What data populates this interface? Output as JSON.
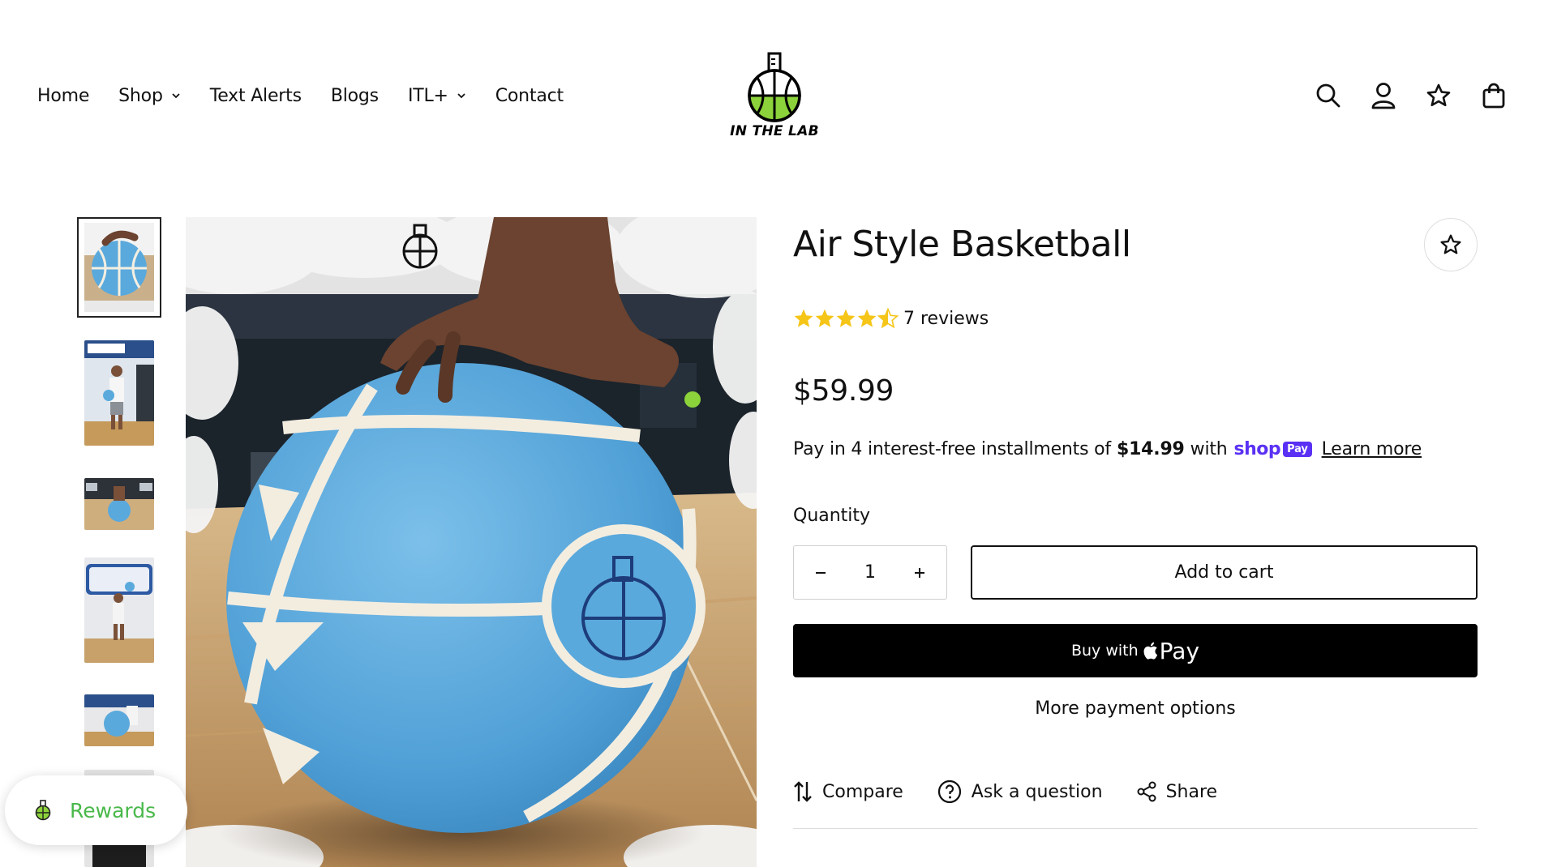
{
  "header": {
    "nav": [
      {
        "label": "Home",
        "has_dropdown": false
      },
      {
        "label": "Shop",
        "has_dropdown": true
      },
      {
        "label": "Text Alerts",
        "has_dropdown": false
      },
      {
        "label": "Blogs",
        "has_dropdown": false
      },
      {
        "label": "ITL+",
        "has_dropdown": true
      },
      {
        "label": "Contact",
        "has_dropdown": false
      }
    ],
    "logo_text": "IN THE LAB",
    "icons": [
      "search-icon",
      "account-icon",
      "wishlist-star-icon",
      "cart-bag-icon"
    ]
  },
  "gallery": {
    "thumbnail_count": 6,
    "selected_index": 0
  },
  "product": {
    "title": "Air Style Basketball",
    "rating": 4.5,
    "rating_max": 5,
    "reviews_label": "7 reviews",
    "price": "$59.99",
    "installments": {
      "prefix": "Pay in 4 interest-free installments of",
      "amount": "$14.99",
      "with": "with",
      "brand_word": "shop",
      "brand_badge": "Pay",
      "learn_more": "Learn more"
    },
    "quantity_label": "Quantity",
    "quantity_value": "1",
    "add_to_cart": "Add to cart",
    "buy_with": "Buy with",
    "apple_pay": "Pay",
    "more_payment": "More payment options",
    "actions": [
      {
        "label": "Compare",
        "icon": "compare-arrows-icon"
      },
      {
        "label": "Ask a question",
        "icon": "question-circle-icon"
      },
      {
        "label": "Share",
        "icon": "share-icon"
      }
    ]
  },
  "rewards": {
    "label": "Rewards"
  },
  "colors": {
    "accent_purple": "#5a31f4",
    "star_gold": "#f5c518",
    "rewards_green": "#49b84a",
    "ball_blue": "#5aa9dc",
    "logo_green": "#8cd23a"
  }
}
